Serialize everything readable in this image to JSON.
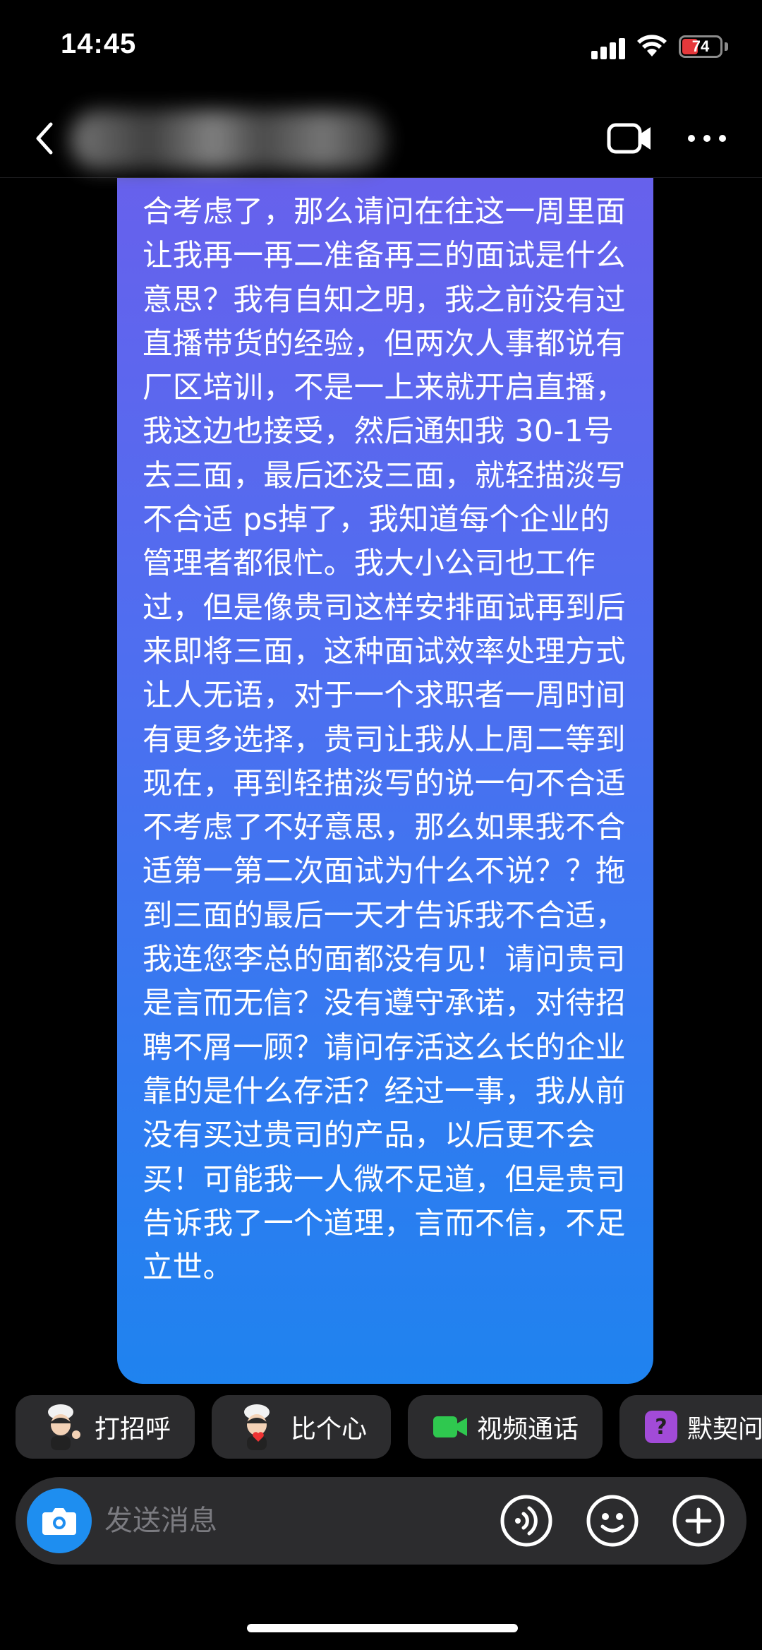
{
  "status_bar": {
    "time": "14:45",
    "battery": "74"
  },
  "nav": {
    "icons": [
      "back-icon",
      "video-call-icon",
      "more-icon"
    ]
  },
  "message": {
    "text": "合考虑了，那么请问在往这一周里面让我再一再二准备再三的面试是什么意思？我有自知之明，我之前没有过直播带货的经验，但两次人事都说有厂区培训，不是一上来就开启直播，我这边也接受，然后通知我 30-1号去三面，最后还没三面，就轻描淡写不合适 ps掉了，我知道每个企业的管理者都很忙。我大小公司也工作过，但是像贵司这样安排面试再到后来即将三面，这种面试效率处理方式让人无语，对于一个求职者一周时间有更多选择，贵司让我从上周二等到现在，再到轻描淡写的说一句不合适不考虑了不好意思，那么如果我不合适第一第二次面试为什么不说？？拖到三面的最后一天才告诉我不合适，我连您李总的面都没有见！请问贵司是言而无信？没有遵守承诺，对待招聘不屑一顾？请问存活这么长的企业靠的是什么存活？经过一事，我从前没有买过贵司的产品，以后更不会买！可能我一人微不足道，但是贵司告诉我了一个道理，言而不信，不足立世。",
    "bubble_color_top": "#6a5fec",
    "bubble_color_bottom": "#1f83ef"
  },
  "quick_actions": [
    {
      "label": "打招呼",
      "icon": "avatar-wave-icon"
    },
    {
      "label": "比个心",
      "icon": "avatar-heart-icon"
    },
    {
      "label": "视频通话",
      "icon": "video-camera-icon",
      "icon_color": "#2fc84f"
    },
    {
      "label": "默契问",
      "icon": "question-box-icon",
      "icon_color": "#a24bd8"
    }
  ],
  "composer": {
    "placeholder": "发送消息",
    "camera_color": "#1e8ef0"
  }
}
